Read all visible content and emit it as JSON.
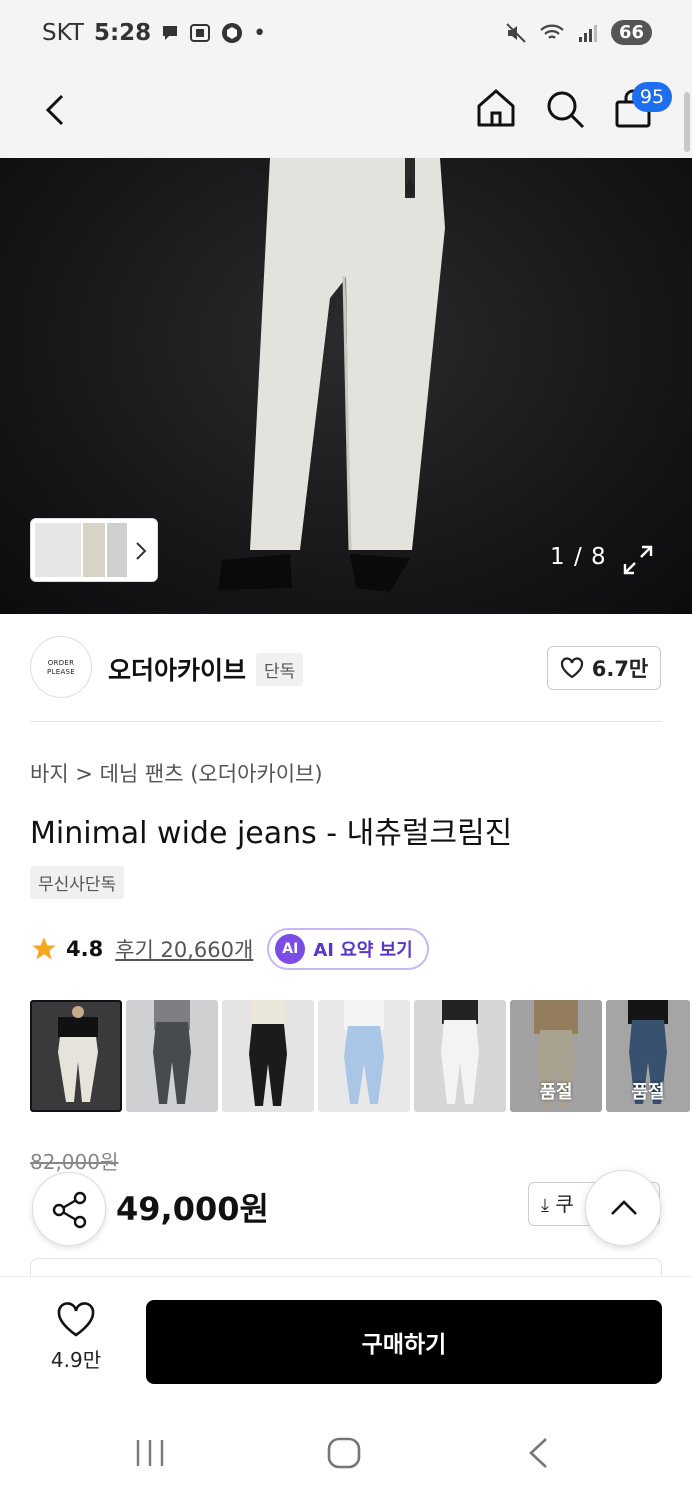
{
  "status_bar": {
    "carrier": "SKT",
    "time": "5:28",
    "battery": "66"
  },
  "header": {
    "cart_count": "95"
  },
  "gallery": {
    "counter": "1 / 8"
  },
  "brand": {
    "logo_text_line1": "ORDER",
    "logo_text_line2": "PLEASE",
    "name": "오더아카이브",
    "tag": "단독",
    "likes": "6.7만"
  },
  "breadcrumb": {
    "category": "바지",
    "subcategory": "데님 팬츠 (오더아카이브)"
  },
  "product": {
    "title": "Minimal wide jeans - 내츄럴크림진",
    "exclusive_tag": "무신사단독",
    "rating": "4.8",
    "reviews": "후기 20,660개",
    "ai_badge": "AI",
    "ai_summary": "AI 요약 보기",
    "original_price": "82,000원",
    "price": "49,000원",
    "coupon_label": "쿠"
  },
  "colors": [
    {
      "selected": true,
      "soldout": ""
    },
    {
      "selected": false,
      "soldout": ""
    },
    {
      "selected": false,
      "soldout": ""
    },
    {
      "selected": false,
      "soldout": ""
    },
    {
      "selected": false,
      "soldout": ""
    },
    {
      "selected": false,
      "soldout": "품절"
    },
    {
      "selected": false,
      "soldout": "품절"
    }
  ],
  "bottom": {
    "wishlist_count": "4.9만",
    "buy_label": "구매하기"
  },
  "accent_colors": {
    "badge_blue": "#1e6ff0",
    "ai_purple": "#7b4ce6",
    "star": "#f5a623"
  }
}
